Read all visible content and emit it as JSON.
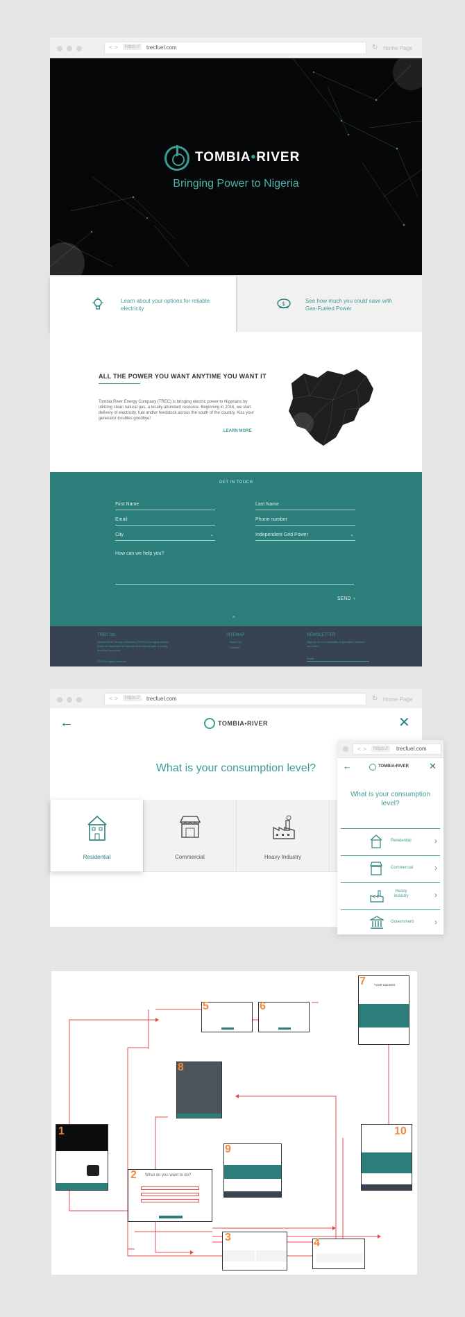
{
  "browser": {
    "protocol": "https://",
    "url": "trecfuel.com",
    "home_label": "Home Page",
    "back_forward": "< >",
    "reload": "↻"
  },
  "hero": {
    "brand": "TOMBIA",
    "brand_separator": "•",
    "brand_second": "RIVER",
    "tagline": "Bringing Power  to Nigeria"
  },
  "options": [
    {
      "icon": "lightbulb-icon",
      "text": "Learn about your options for reliable electricity"
    },
    {
      "icon": "money-bag-icon",
      "text": "See how much you could save with Gas-Fueled Power"
    }
  ],
  "about": {
    "title": "ALL THE POWER YOU WANT ANYTIME YOU WANT IT",
    "body": "Tombia River Energy Company (TREC) is bringing electric power to Nigerians by utilizing clean natural gas, a locally abundant resource. Beginning in 2016, we start delivery of electricity, fuel and/or  feedstock across the south of the country.  Kiss your generator troubles goodbye!",
    "link": "LEARN MORE"
  },
  "contact": {
    "title": "GET IN TOUCH",
    "first_name": "First Name",
    "last_name": "Last Name",
    "email": "Email",
    "phone": "Phone number",
    "city": "City",
    "grid": "Independent Grid Power",
    "message": "How can we help you?",
    "send": "SEND",
    "send_icon": "›",
    "up_icon": "^"
  },
  "footer": {
    "col1_title": "TREC Inc.",
    "col1_text": "Tombia River Energy Company (TREC) is bringing electric power to Nigerians by utilizing clean natural gas, a locally abundant resource.",
    "col1_copy": "2015 All rights reserved",
    "col2_title": "SITEMAP",
    "col2_links": [
      "About Us",
      "Contact"
    ],
    "col3_title": "NEWSLETTER",
    "col3_text": "Sign up for our newsletter to get latest updates and offers",
    "col3_email": "Email"
  },
  "consumption": {
    "brand": "TOMBIA•RIVER",
    "question": "What is your consumption level?",
    "back_icon": "←",
    "close_icon": "✕",
    "categories": [
      "Residential",
      "Commercial",
      "Heavy Industry"
    ]
  },
  "mobile": {
    "question": "What is your consumption level?",
    "items": [
      "Residential",
      "Commercial",
      "Heavy Industry",
      "Government"
    ],
    "chevron": "›"
  },
  "flow": {
    "numbers": [
      "1",
      "2",
      "3",
      "4",
      "5",
      "6",
      "7",
      "8",
      "9",
      "10"
    ],
    "screen2_title": "What do you want to do?",
    "screen7_title": "YOUR SAVINGS"
  },
  "colors": {
    "teal": "#3f9b95",
    "teal_dark": "#2b7e7a",
    "footer": "#384352",
    "arrow": "#e8484b",
    "step_number": "#f08a3c"
  }
}
